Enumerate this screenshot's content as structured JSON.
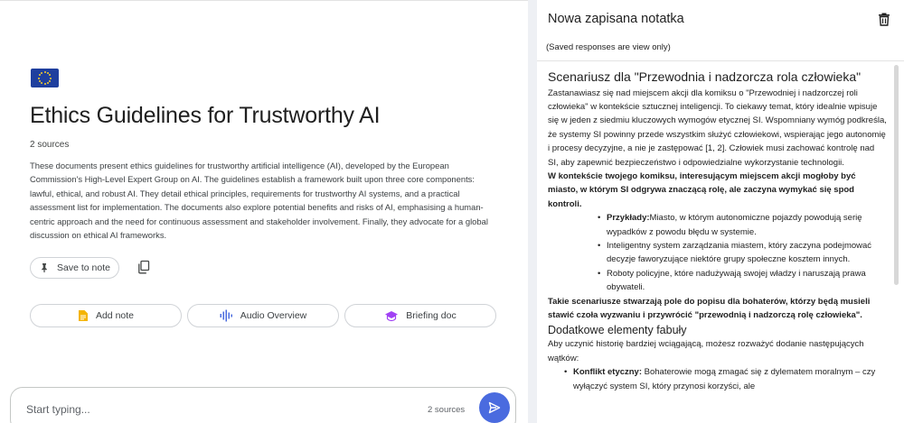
{
  "notebook": {
    "title": "Ethics Guidelines for Trustworthy AI",
    "sources_count": "2 sources",
    "summary": "These documents present ethics guidelines for trustworthy artificial intelligence (AI), developed by the European Commission's High-Level Expert Group on AI. The guidelines establish a framework built upon three core components: lawful, ethical, and robust AI. They detail ethical principles, requirements for trustworthy AI systems, and a practical assessment list for implementation. The documents also explore potential benefits and risks of AI, emphasising a human-centric approach and the need for continuous assessment and stakeholder involvement. Finally, they advocate for a global discussion on ethical AI frameworks.",
    "save_to_note_label": "Save to note",
    "flag_icon": "eu-flag-icon"
  },
  "actions": {
    "add_note": "Add note",
    "audio_overview": "Audio Overview",
    "briefing_doc": "Briefing doc"
  },
  "chat": {
    "placeholder": "Start typing...",
    "sources": "2 sources"
  },
  "note": {
    "title": "Nowa zapisana notatka",
    "view_only": "(Saved responses are view only)",
    "heading": "Scenariusz dla \"Przewodnia i nadzorcza rola człowieka\"",
    "intro": "Zastanawiasz się nad miejscem akcji dla komiksu o \"Przewodniej i nadzorczej roli człowieka\" w kontekście sztucznej inteligencji. To ciekawy temat, który idealnie wpisuje się w jeden z siedmiu kluczowych wymogów etycznej SI. Wspomniany wymóg podkreśla, że systemy SI powinny przede wszystkim służyć człowiekowi, wspierając jego autonomię i procesy decyzyjne, a nie je zastępować [1, 2]. Człowiek musi zachować kontrolę nad SI, aby zapewnić bezpieczeństwo i odpowiedzialne wykorzystanie technologii.",
    "bold_para": "W kontekście twojego komiksu, interesującym miejscem akcji mogłoby być miasto, w którym SI odgrywa znaczącą rolę, ale zaczyna wymykać się spod kontroli.",
    "examples_label": "Przykłady:",
    "examples_first": "Miasto, w którym autonomiczne pojazdy powodują serię wypadków z powodu błędu w systemie.",
    "examples": [
      "Inteligentny system zarządzania miastem, który zaczyna podejmować decyzje faworyzujące niektóre grupy społeczne kosztem innych.",
      "Roboty policyjne, które nadużywają swojej władzy i naruszają prawa obywateli."
    ],
    "closing_bold": "Takie scenariusze stwarzają pole do popisu dla bohaterów, którzy będą musieli stawić czoła wyzwaniu i przywrócić \"przewodnią i nadzorczą rolę człowieka\".",
    "subheading": "Dodatkowe elementy fabuły",
    "sub_intro": "Aby uczynić historię bardziej wciągającą, możesz rozważyć dodanie następujących wątków:",
    "plot_label": "Konflikt etyczny:",
    "plot_text": "Bohaterowie mogą zmagać się z dylematem moralnym – czy wyłączyć system SI, który przynosi korzyści, ale"
  },
  "colors": {
    "send_button": "#4a6bdf",
    "flag_blue": "#1f3f9e",
    "flag_star": "#f7d02c",
    "note_icon": "#f4b400",
    "audio_icon": "#4a6bdf",
    "briefing_icon": "#a142f4"
  }
}
